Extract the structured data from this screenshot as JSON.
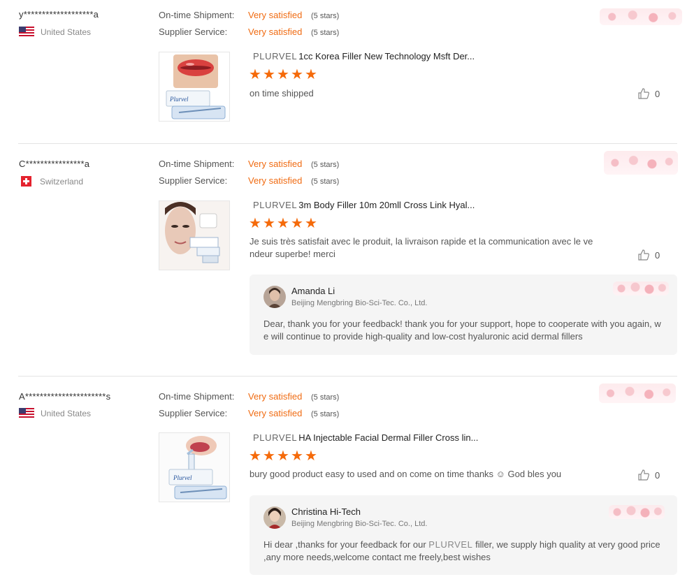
{
  "labels": {
    "ontime": "On-time Shipment:",
    "supplier": "Supplier Service:"
  },
  "colors": {
    "accent": "#f06b12",
    "star": "#f56a0a"
  },
  "reviews": [
    {
      "buyer": "y*******************a",
      "country": "United States",
      "ontime_value": "Very satisfied",
      "ontime_stars": "(5 stars)",
      "supplier_value": "Very satisfied",
      "supplier_stars": "(5 stars)",
      "product_brand": "PLURVEL",
      "product_title": "1cc Korea Filler New Technology Msft Der...",
      "rating": 5,
      "comment": "on time shipped",
      "likes": "0"
    },
    {
      "buyer": "C****************a",
      "country": "Switzerland",
      "ontime_value": "Very satisfied",
      "ontime_stars": "(5 stars)",
      "supplier_value": "Very satisfied",
      "supplier_stars": "(5 stars)",
      "product_brand": "PLURVEL",
      "product_title": "3m Body Filler 10m 20mll Cross Link Hyal...",
      "rating": 5,
      "comment": "Je suis très satisfait avec le produit, la livraison rapide et la communication avec le vendeur superbe! merci",
      "likes": "0",
      "reply": {
        "name": "Amanda Li",
        "company": "Beijing Mengbring Bio-Sci-Tec. Co., Ltd.",
        "text": "Dear, thank you for your feedback! thank you for your support, hope to cooperate with you again, we will continue to provide high-quality and low-cost hyaluronic acid dermal fillers"
      }
    },
    {
      "buyer": "A**********************s",
      "country": "United States",
      "ontime_value": "Very satisfied",
      "ontime_stars": "(5 stars)",
      "supplier_value": "Very satisfied",
      "supplier_stars": "(5 stars)",
      "product_brand": "PLURVEL",
      "product_title": "HA Injectable Facial Dermal Filler Cross lin...",
      "rating": 5,
      "comment": "bury good product easy to used and on come on  time thanks ☺ God bles you",
      "likes": "0",
      "reply": {
        "name": "Christina Hi-Tech",
        "company": "Beijing Mengbring Bio-Sci-Tec. Co., Ltd.",
        "text_before": "Hi dear ,thanks for your feedback for our ",
        "text_brand": "PLURVEL",
        "text_after": " filler, we supply high quality at very good price ,any more needs,welcome contact me freely,best wishes"
      }
    }
  ]
}
